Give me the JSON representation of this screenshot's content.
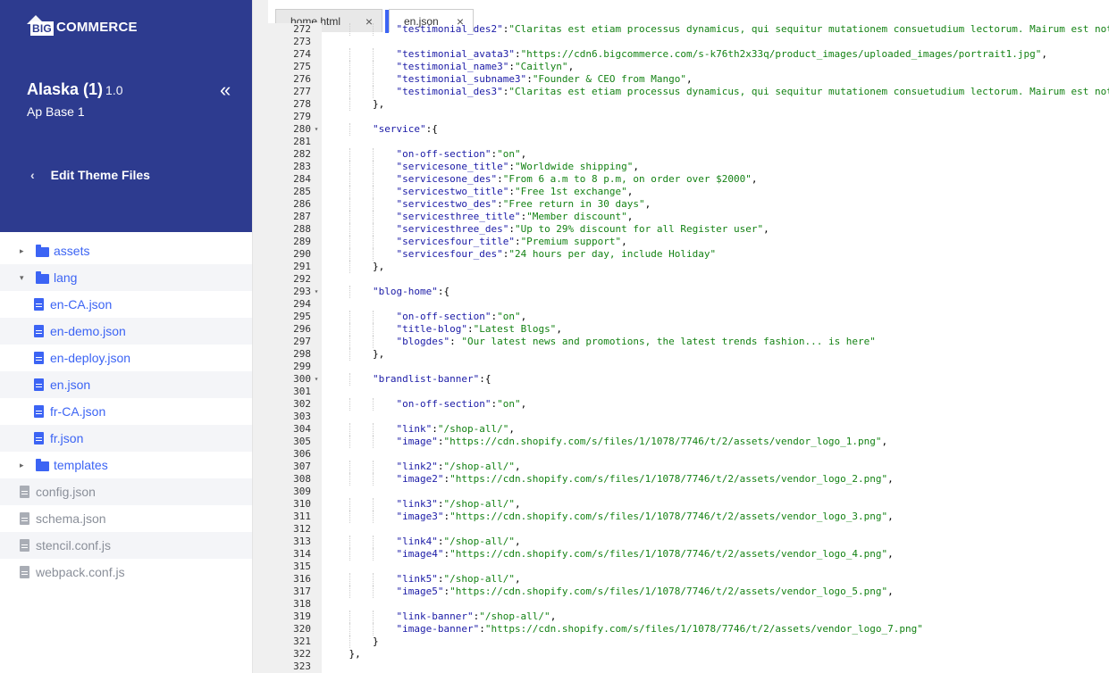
{
  "sidebar": {
    "logo": {
      "big": "BIG",
      "rest": "COMMERCE"
    },
    "store_title": "Alaska (1)",
    "store_version": "1.0",
    "store_subtitle": "Ap Base 1",
    "collapse_icon": "double-chevron-left-icon",
    "collapse_glyph": "«",
    "back_glyph": "‹",
    "edit_theme_label": "Edit Theme Files",
    "tree": [
      {
        "type": "folder",
        "label": "assets",
        "expanded": false,
        "caret": "▸"
      },
      {
        "type": "folder",
        "label": "lang",
        "expanded": true,
        "caret": "▾"
      },
      {
        "type": "file",
        "label": "en-CA.json"
      },
      {
        "type": "file",
        "label": "en-demo.json"
      },
      {
        "type": "file",
        "label": "en-deploy.json"
      },
      {
        "type": "file",
        "label": "en.json"
      },
      {
        "type": "file",
        "label": "fr-CA.json"
      },
      {
        "type": "file",
        "label": "fr.json"
      },
      {
        "type": "folder",
        "label": "templates",
        "expanded": false,
        "caret": "▸"
      },
      {
        "type": "rootfile",
        "label": "config.json"
      },
      {
        "type": "rootfile",
        "label": "schema.json"
      },
      {
        "type": "rootfile",
        "label": "stencil.conf.js"
      },
      {
        "type": "rootfile",
        "label": "webpack.conf.js"
      }
    ]
  },
  "editor": {
    "tabs": [
      {
        "label": "home.html",
        "close": "×",
        "active": false
      },
      {
        "label": "en.json",
        "close": "×",
        "active": true
      }
    ],
    "lines": [
      {
        "n": "272",
        "indent": 3,
        "text": "\"testimonial_des2\":\"Claritas est etiam processus dynamicus, qui sequitur mutationem consuetudium lectorum. Mairum est not"
      },
      {
        "n": "273",
        "indent": 0,
        "text": ""
      },
      {
        "n": "274",
        "indent": 3,
        "text": "\"testimonial_avata3\":\"https://cdn6.bigcommerce.com/s-k76th2x33q/product_images/uploaded_images/portrait1.jpg\","
      },
      {
        "n": "275",
        "indent": 3,
        "text": "\"testimonial_name3\":\"Caitlyn\","
      },
      {
        "n": "276",
        "indent": 3,
        "text": "\"testimonial_subname3\":\"Founder & CEO from Mango\","
      },
      {
        "n": "277",
        "indent": 3,
        "text": "\"testimonial_des3\":\"Claritas est etiam processus dynamicus, qui sequitur mutationem consuetudium lectorum. Mairum est not"
      },
      {
        "n": "278",
        "indent": 2,
        "text": "},"
      },
      {
        "n": "279",
        "indent": 0,
        "text": ""
      },
      {
        "n": "280",
        "indent": 2,
        "fold": true,
        "text": "\"service\":{"
      },
      {
        "n": "281",
        "indent": 0,
        "text": ""
      },
      {
        "n": "282",
        "indent": 3,
        "text": "\"on-off-section\":\"on\","
      },
      {
        "n": "283",
        "indent": 3,
        "text": "\"servicesone_title\":\"Worldwide shipping\","
      },
      {
        "n": "284",
        "indent": 3,
        "text": "\"servicesone_des\":\"From 6 a.m to 8 p.m, on order over $2000\","
      },
      {
        "n": "285",
        "indent": 3,
        "text": "\"servicestwo_title\":\"Free 1st exchange\","
      },
      {
        "n": "286",
        "indent": 3,
        "text": "\"servicestwo_des\":\"Free return in 30 days\","
      },
      {
        "n": "287",
        "indent": 3,
        "text": "\"servicesthree_title\":\"Member discount\","
      },
      {
        "n": "288",
        "indent": 3,
        "text": "\"servicesthree_des\":\"Up to 29% discount for all Register user\","
      },
      {
        "n": "289",
        "indent": 3,
        "text": "\"servicesfour_title\":\"Premium support\","
      },
      {
        "n": "290",
        "indent": 3,
        "text": "\"servicesfour_des\":\"24 hours per day, include Holiday\""
      },
      {
        "n": "291",
        "indent": 2,
        "text": "},"
      },
      {
        "n": "292",
        "indent": 0,
        "text": ""
      },
      {
        "n": "293",
        "indent": 2,
        "fold": true,
        "text": "\"blog-home\":{"
      },
      {
        "n": "294",
        "indent": 0,
        "text": ""
      },
      {
        "n": "295",
        "indent": 3,
        "text": "\"on-off-section\":\"on\","
      },
      {
        "n": "296",
        "indent": 3,
        "text": "\"title-blog\":\"Latest Blogs\","
      },
      {
        "n": "297",
        "indent": 3,
        "text": "\"blogdes\": \"Our latest news and promotions, the latest trends fashion... is here\""
      },
      {
        "n": "298",
        "indent": 2,
        "text": "},"
      },
      {
        "n": "299",
        "indent": 0,
        "text": ""
      },
      {
        "n": "300",
        "indent": 2,
        "fold": true,
        "text": "\"brandlist-banner\":{"
      },
      {
        "n": "301",
        "indent": 0,
        "text": ""
      },
      {
        "n": "302",
        "indent": 3,
        "text": "\"on-off-section\":\"on\","
      },
      {
        "n": "303",
        "indent": 0,
        "text": ""
      },
      {
        "n": "304",
        "indent": 3,
        "text": "\"link\":\"/shop-all/\","
      },
      {
        "n": "305",
        "indent": 3,
        "text": "\"image\":\"https://cdn.shopify.com/s/files/1/1078/7746/t/2/assets/vendor_logo_1.png\","
      },
      {
        "n": "306",
        "indent": 0,
        "text": ""
      },
      {
        "n": "307",
        "indent": 3,
        "text": "\"link2\":\"/shop-all/\","
      },
      {
        "n": "308",
        "indent": 3,
        "text": "\"image2\":\"https://cdn.shopify.com/s/files/1/1078/7746/t/2/assets/vendor_logo_2.png\","
      },
      {
        "n": "309",
        "indent": 0,
        "text": ""
      },
      {
        "n": "310",
        "indent": 3,
        "text": "\"link3\":\"/shop-all/\","
      },
      {
        "n": "311",
        "indent": 3,
        "text": "\"image3\":\"https://cdn.shopify.com/s/files/1/1078/7746/t/2/assets/vendor_logo_3.png\","
      },
      {
        "n": "312",
        "indent": 0,
        "text": ""
      },
      {
        "n": "313",
        "indent": 3,
        "text": "\"link4\":\"/shop-all/\","
      },
      {
        "n": "314",
        "indent": 3,
        "text": "\"image4\":\"https://cdn.shopify.com/s/files/1/1078/7746/t/2/assets/vendor_logo_4.png\","
      },
      {
        "n": "315",
        "indent": 0,
        "text": ""
      },
      {
        "n": "316",
        "indent": 3,
        "text": "\"link5\":\"/shop-all/\","
      },
      {
        "n": "317",
        "indent": 3,
        "text": "\"image5\":\"https://cdn.shopify.com/s/files/1/1078/7746/t/2/assets/vendor_logo_5.png\","
      },
      {
        "n": "318",
        "indent": 0,
        "text": ""
      },
      {
        "n": "319",
        "indent": 3,
        "text": "\"link-banner\":\"/shop-all/\","
      },
      {
        "n": "320",
        "indent": 3,
        "text": "\"image-banner\":\"https://cdn.shopify.com/s/files/1/1078/7746/t/2/assets/vendor_logo_7.png\""
      },
      {
        "n": "321",
        "indent": 2,
        "text": "}"
      },
      {
        "n": "322",
        "indent": 1,
        "text": "},"
      },
      {
        "n": "323",
        "indent": 0,
        "text": ""
      }
    ]
  },
  "colors": {
    "header_bg": "#2d3b8f",
    "link_blue": "#3c64f4",
    "string_green": "#148214",
    "key_blue": "#1a1aa6"
  }
}
